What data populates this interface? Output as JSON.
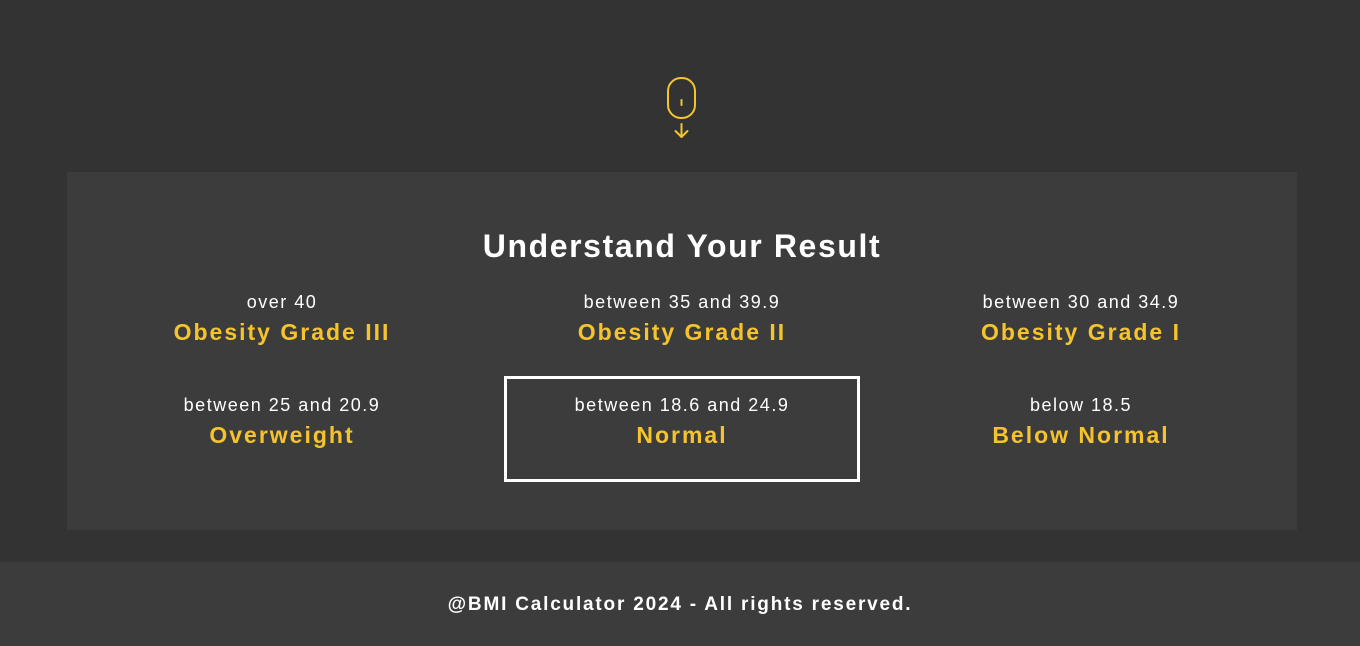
{
  "scroll_indicator": {
    "icon": "mouse-scroll-down-icon",
    "color": "#f5c42c"
  },
  "results": {
    "title": "Understand Your Result",
    "categories": [
      {
        "range": "over 40",
        "label": "Obesity Grade III",
        "highlighted": false
      },
      {
        "range": "between 35 and 39.9",
        "label": "Obesity Grade II",
        "highlighted": false
      },
      {
        "range": "between 30 and 34.9",
        "label": "Obesity Grade I",
        "highlighted": false
      },
      {
        "range": "between 25 and 20.9",
        "label": "Overweight",
        "highlighted": false
      },
      {
        "range": "between 18.6 and 24.9",
        "label": "Normal",
        "highlighted": true
      },
      {
        "range": "below 18.5",
        "label": "Below Normal",
        "highlighted": false
      }
    ]
  },
  "footer": {
    "text": "@BMI Calculator 2024 - All rights reserved."
  },
  "colors": {
    "background": "#333333",
    "panel": "#3c3c3c",
    "accent": "#f5c42c",
    "text": "#ffffff"
  }
}
